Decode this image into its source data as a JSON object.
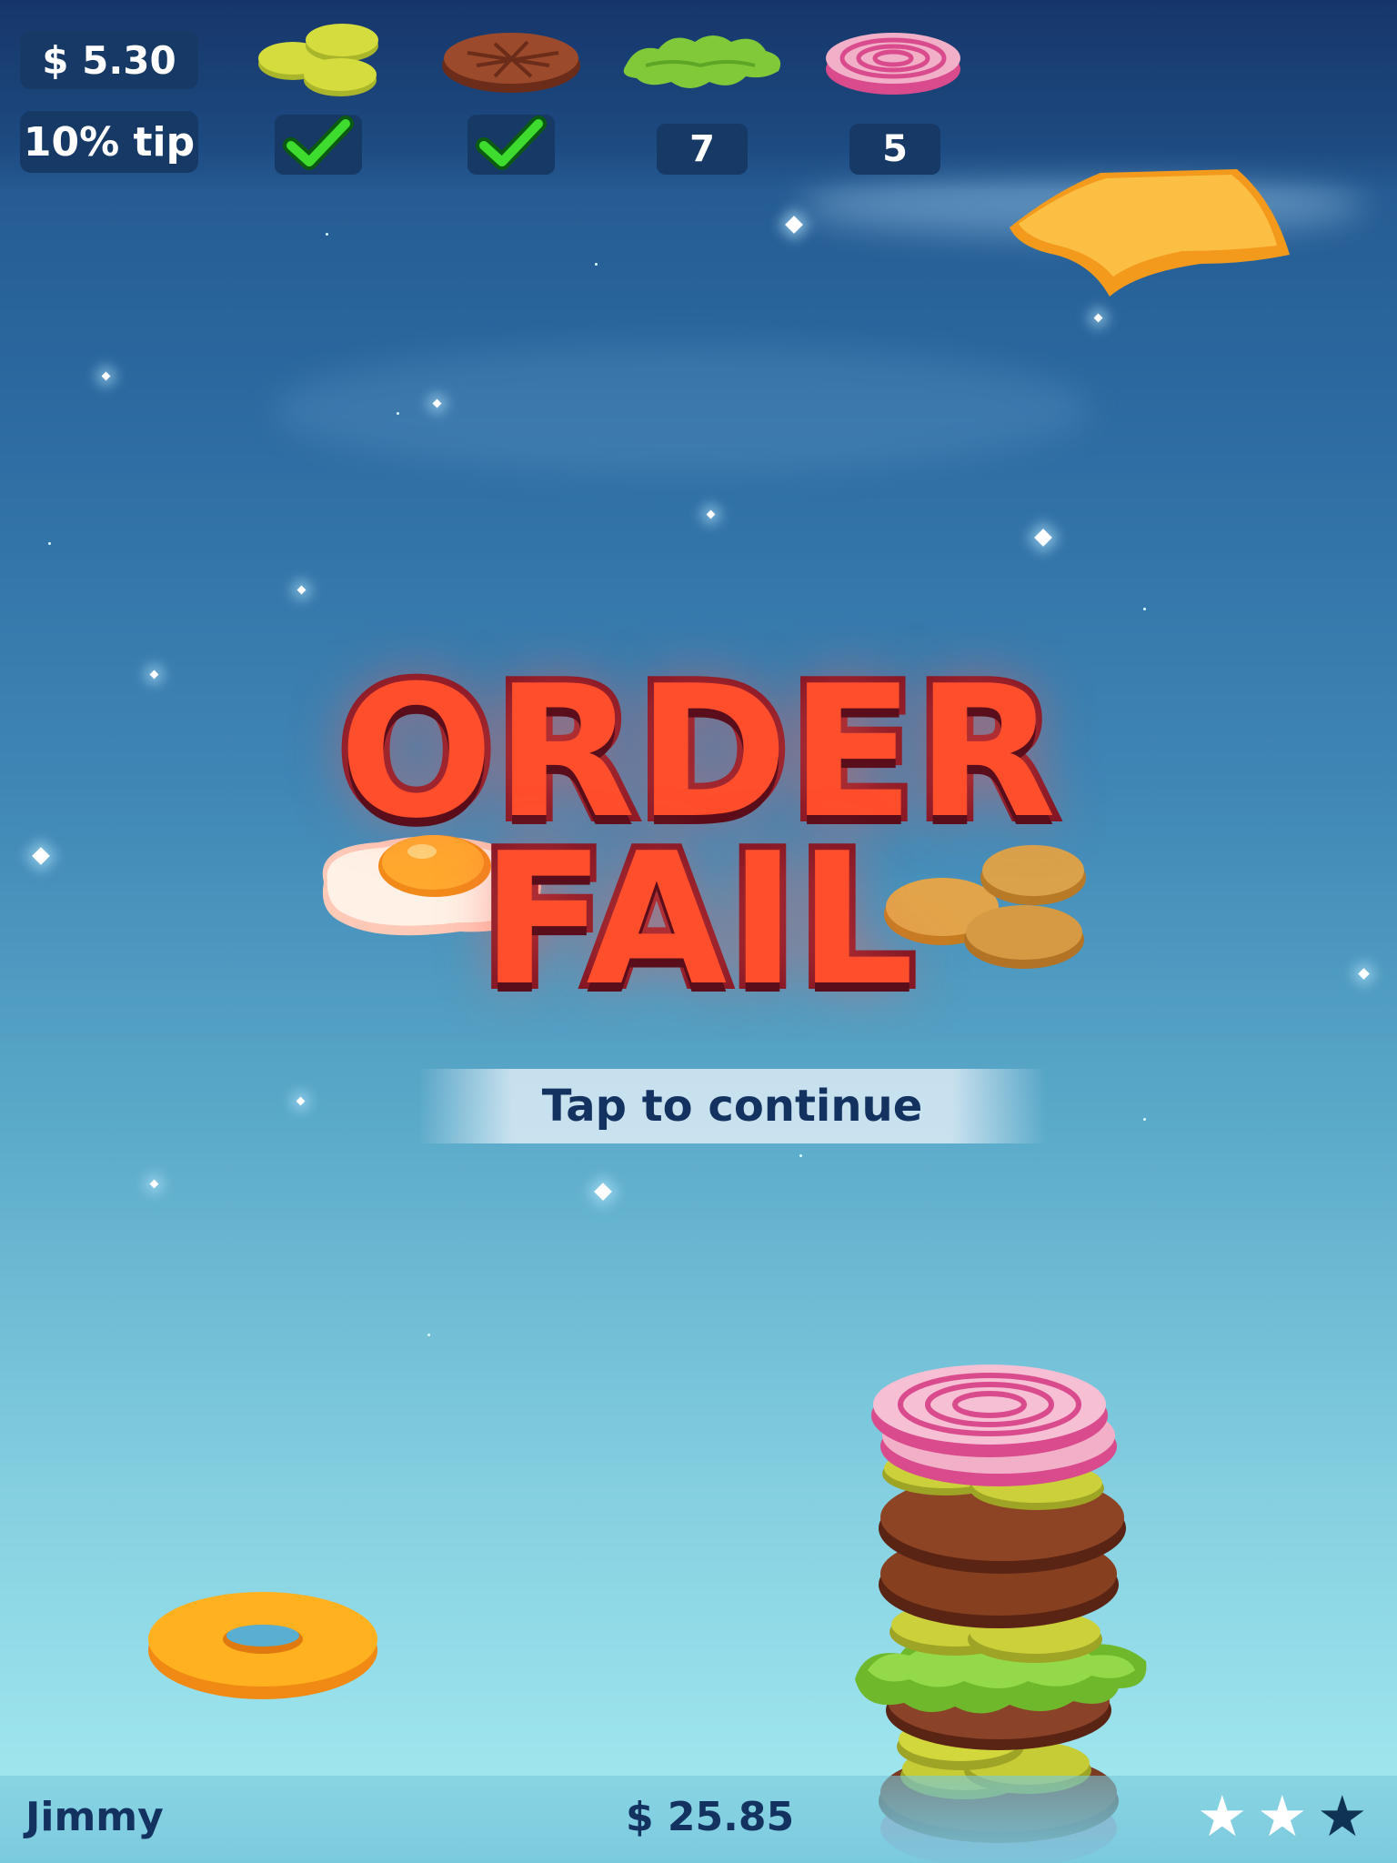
{
  "hud": {
    "money": "$ 5.30",
    "tip": "10% tip",
    "order": [
      {
        "ingredient": "pickles",
        "icon": "pickle-icon",
        "status": "check-icon"
      },
      {
        "ingredient": "patty",
        "icon": "patty-icon",
        "status": "check-icon"
      },
      {
        "ingredient": "lettuce",
        "icon": "lettuce-icon",
        "count": "7"
      },
      {
        "ingredient": "onion",
        "icon": "onion-icon",
        "count": "5"
      }
    ]
  },
  "message": {
    "line1": "ORDER",
    "line2": "FAIL",
    "tap": "Tap to continue"
  },
  "footer": {
    "player": "Jimmy",
    "total": "$ 25.85",
    "stars": {
      "filled": 2,
      "total": 3
    }
  },
  "colors": {
    "title": "#ff4e2c",
    "title_outline": "#7a1222",
    "hud_panel": "#173966",
    "check": "#3ddc2f",
    "text_dark": "#13325f"
  }
}
